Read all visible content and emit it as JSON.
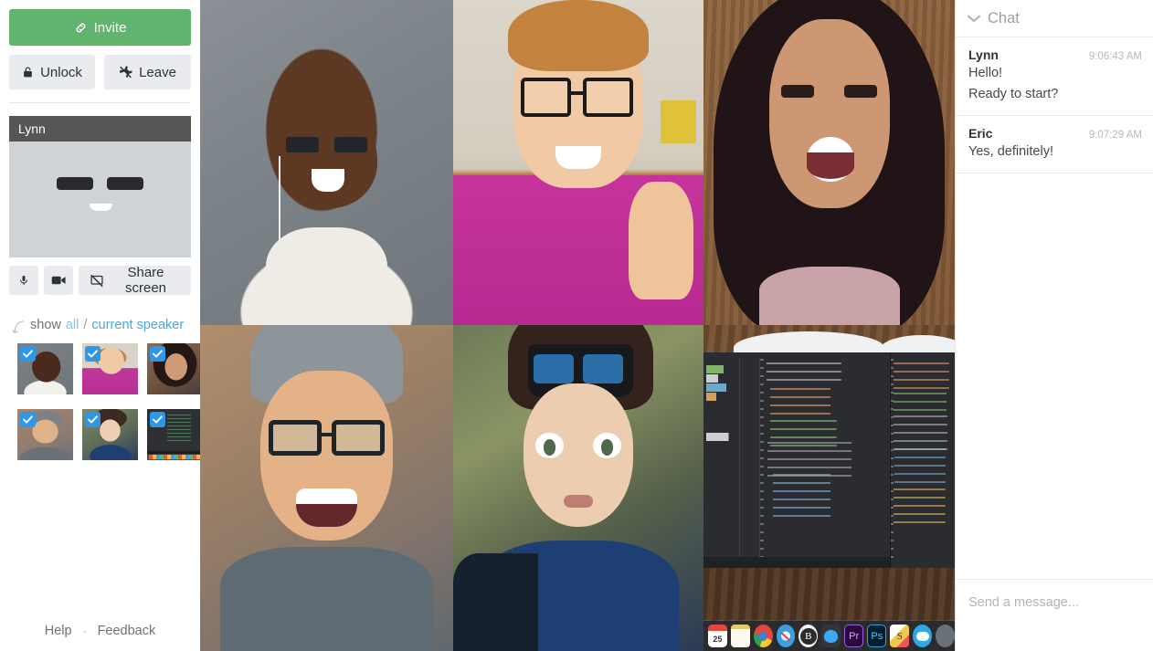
{
  "sidebar": {
    "invite_label": "Invite",
    "invite_icon": "link-icon",
    "invite_color": "#60b46e",
    "unlock_label": "Unlock",
    "unlock_icon": "lock-icon",
    "leave_label": "Leave",
    "leave_icon": "leave-icon",
    "self_tile": {
      "name": "Lynn"
    },
    "controls": {
      "mic_icon": "microphone-icon",
      "camera_icon": "video-camera-icon",
      "share_label": "Share screen",
      "share_icon": "share-screen-off-icon"
    },
    "show": {
      "prefix": "show",
      "all_label": "all",
      "separator": "/",
      "speaker_label": "current speaker",
      "all_color": "#7fc4ea",
      "speaker_color": "#4aa8dd"
    },
    "thumbnails": [
      {
        "name": "participant-1",
        "checked": true
      },
      {
        "name": "participant-2",
        "checked": true
      },
      {
        "name": "participant-3",
        "checked": true
      },
      {
        "name": "participant-4",
        "checked": true
      },
      {
        "name": "participant-5",
        "checked": true
      },
      {
        "name": "screen-share",
        "checked": true
      }
    ],
    "footer": {
      "help_label": "Help",
      "separator": "·",
      "feedback_label": "Feedback"
    }
  },
  "grid": {
    "cells": [
      {
        "name": "video-tile-1"
      },
      {
        "name": "video-tile-2"
      },
      {
        "name": "video-tile-3"
      },
      {
        "name": "video-tile-4"
      },
      {
        "name": "video-tile-5"
      },
      {
        "name": "video-tile-screenshare"
      }
    ]
  },
  "chat": {
    "title": "Chat",
    "collapse_icon": "chevron-down-icon",
    "messages": [
      {
        "author": "Lynn",
        "time": "9:06:43 AM",
        "lines": [
          "Hello!",
          "Ready to start?"
        ]
      },
      {
        "author": "Eric",
        "time": "9:07:29 AM",
        "lines": [
          "Yes, definitely!"
        ]
      }
    ],
    "input": {
      "value": "",
      "placeholder": "Send a message..."
    }
  }
}
